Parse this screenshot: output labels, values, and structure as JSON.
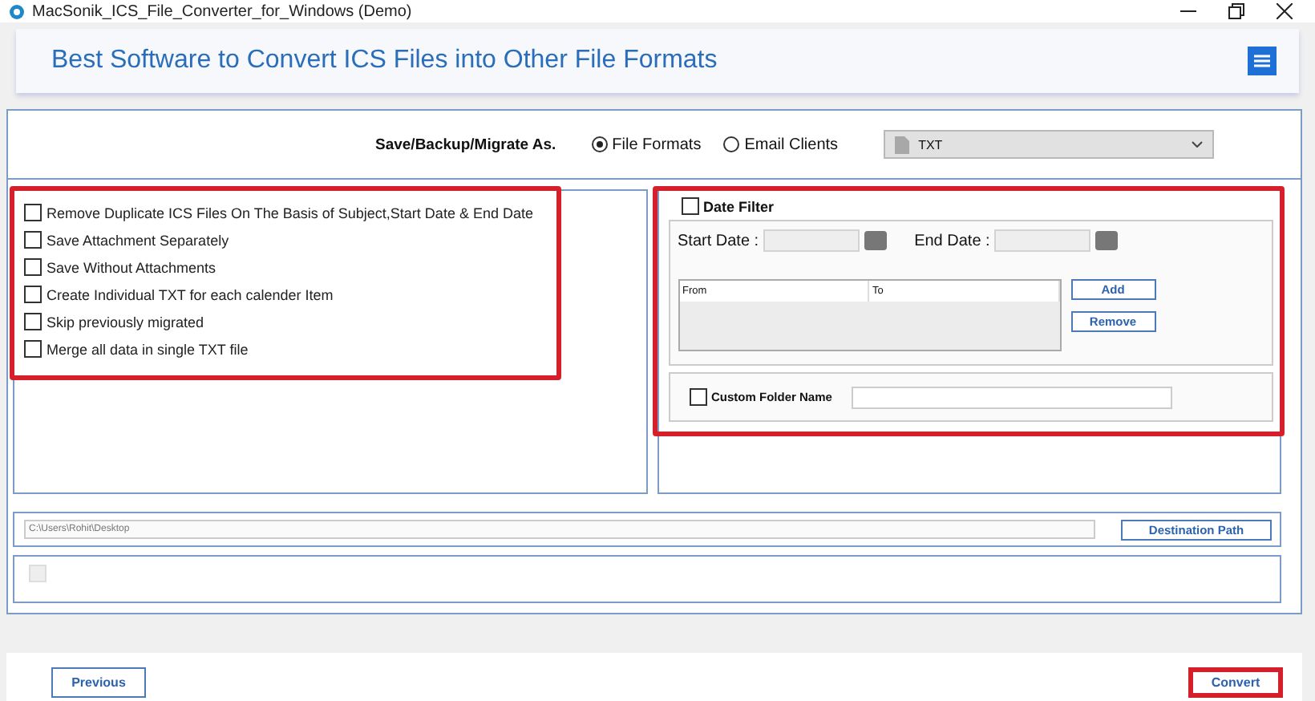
{
  "window": {
    "title": "MacSonik_ICS_File_Converter_for_Windows (Demo)"
  },
  "header": {
    "title": "Best Software to Convert ICS Files into Other File Formats"
  },
  "save_as": {
    "label": "Save/Backup/Migrate As.",
    "format": "TXT",
    "options": [
      {
        "label": "File Formats",
        "selected": true
      },
      {
        "label": "Email Clients",
        "selected": false
      }
    ]
  },
  "options": {
    "highlighted": true,
    "items": [
      {
        "label": "Remove Duplicate ICS Files On The Basis of Subject,Start Date & End Date",
        "checked": false
      },
      {
        "label": "Save Attachment Separately",
        "checked": false
      },
      {
        "label": "Save Without Attachments",
        "checked": false
      },
      {
        "label": "Create Individual TXT for each calender Item",
        "checked": false
      },
      {
        "label": "Skip previously migrated",
        "checked": false
      },
      {
        "label": "Merge all data in single TXT file",
        "checked": false
      }
    ]
  },
  "date_filter": {
    "highlighted": true,
    "label": "Date Filter",
    "checked": false,
    "start_label": "Start Date :",
    "end_label": "End Date :",
    "columns": [
      "From",
      "To"
    ],
    "buttons": [
      "Add",
      "Remove"
    ],
    "custom_folder": {
      "label": "Custom Folder Name",
      "checked": false
    }
  },
  "destination": {
    "path": "C:\\Users\\Rohit\\Desktop",
    "button": "Destination Path"
  },
  "log_panel": {
    "checkbox": {
      "checked": false,
      "disabled": true
    }
  },
  "footer": {
    "previous": "Previous",
    "convert": {
      "label": "Convert",
      "highlighted": true
    }
  }
}
